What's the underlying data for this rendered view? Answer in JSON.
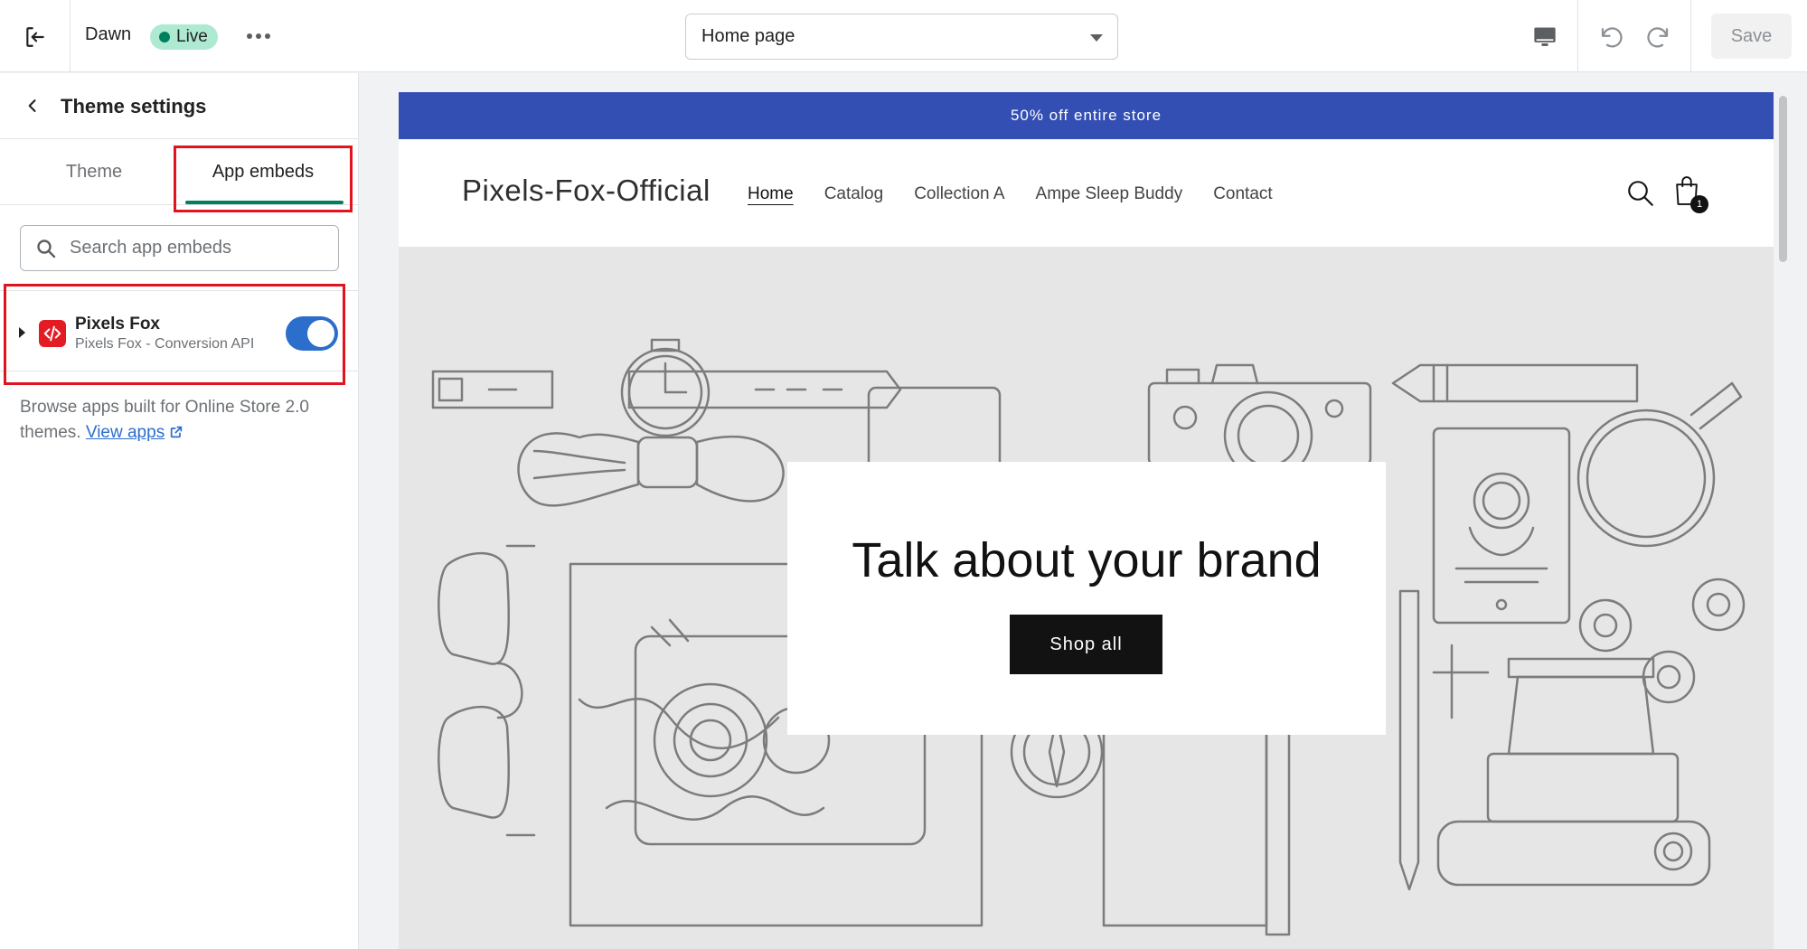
{
  "topbar": {
    "theme_name": "Dawn",
    "status_badge": "Live",
    "page_selector": "Home page",
    "save_label": "Save"
  },
  "sidebar": {
    "title": "Theme settings",
    "tabs": [
      {
        "label": "Theme",
        "active": false
      },
      {
        "label": "App embeds",
        "active": true
      }
    ],
    "search": {
      "placeholder": "Search app embeds",
      "value": ""
    },
    "app_embed": {
      "name": "Pixels Fox",
      "subtitle": "Pixels Fox - Conversion API",
      "enabled": true
    },
    "browse_text": "Browse apps built for Online Store 2.0 themes.",
    "view_apps_label": "View apps"
  },
  "preview": {
    "announcement": "50% off entire store",
    "store_name": "Pixels-Fox-Official",
    "nav": [
      "Home",
      "Catalog",
      "Collection A",
      "Ampe Sleep Buddy",
      "Contact"
    ],
    "cart_count": "1",
    "hero_heading": "Talk about your brand",
    "hero_button": "Shop all"
  },
  "colors": {
    "accent_green": "#008060",
    "toggle_blue": "#2c6ecb",
    "announcement_bg": "#334fb4",
    "highlight_red": "#e0141e",
    "live_badge_bg": "#aee9d1",
    "app_logo_red": "#e31b23"
  },
  "icons": {
    "exit": "exit-icon",
    "more": "more-horizontal-icon",
    "desktop": "desktop-icon",
    "undo": "undo-icon",
    "redo": "redo-icon",
    "back": "chevron-left-icon",
    "search": "search-icon",
    "external": "external-link-icon",
    "cart": "shopping-bag-icon"
  }
}
